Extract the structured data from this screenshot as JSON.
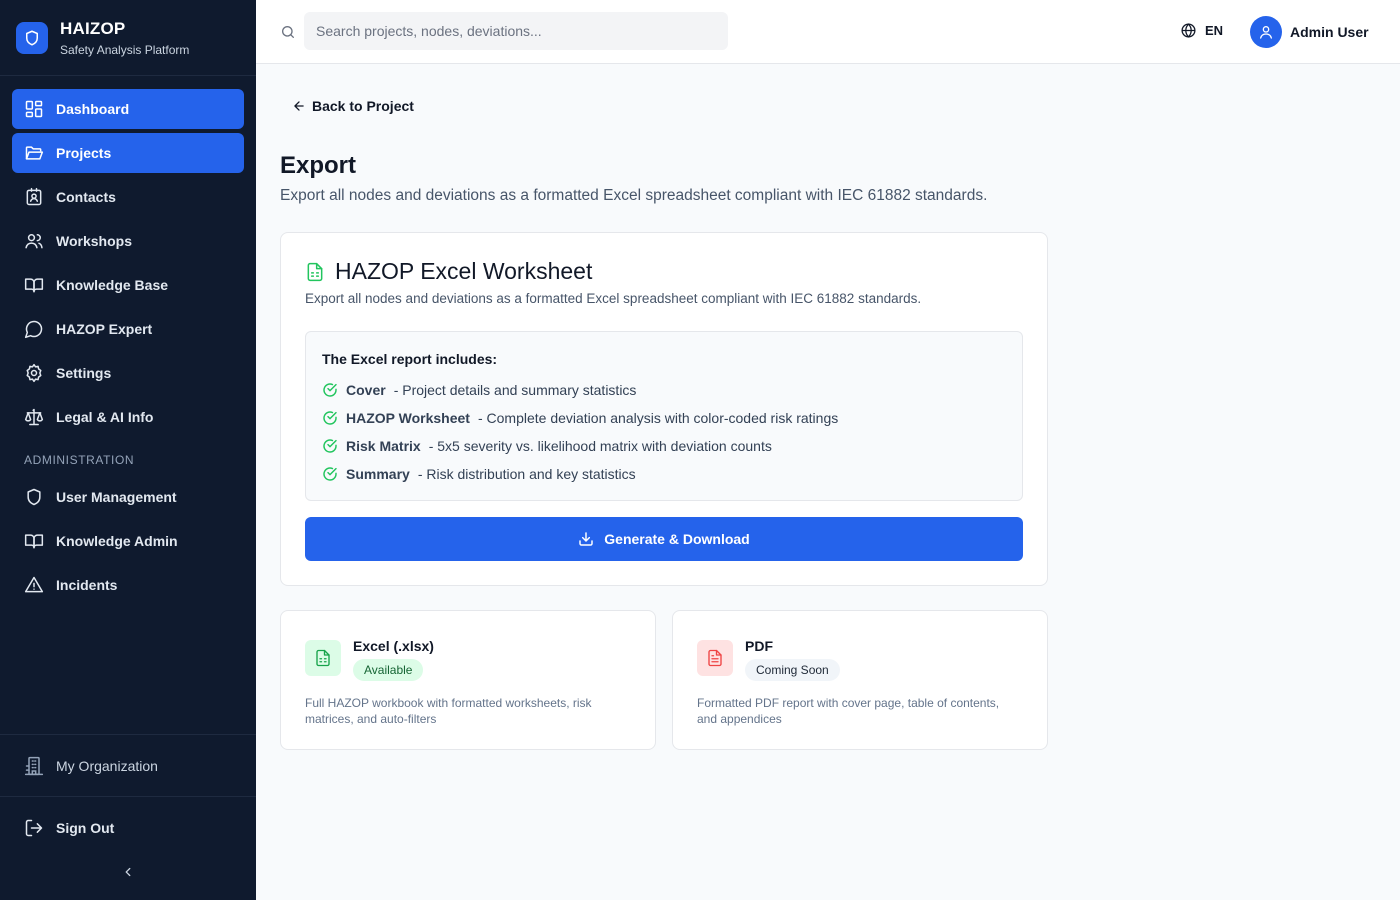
{
  "brand": {
    "title": "HAIZOP",
    "subtitle": "Safety Analysis Platform"
  },
  "sidebar": {
    "items": [
      {
        "label": "Dashboard",
        "icon": "dashboard-grid-icon",
        "active": true
      },
      {
        "label": "Projects",
        "icon": "folder-open-icon",
        "active": true
      },
      {
        "label": "Contacts",
        "icon": "contact-badge-icon"
      },
      {
        "label": "Workshops",
        "icon": "users-icon"
      },
      {
        "label": "Knowledge Base",
        "icon": "book-open-icon"
      },
      {
        "label": "HAZOP Expert",
        "icon": "chat-bubble-icon"
      },
      {
        "label": "Settings",
        "icon": "gear-icon"
      },
      {
        "label": "Legal & AI Info",
        "icon": "scale-icon"
      }
    ],
    "section_label": "ADMINISTRATION",
    "admin_items": [
      {
        "label": "User Management",
        "icon": "shield-icon"
      },
      {
        "label": "Knowledge Admin",
        "icon": "book-open-icon"
      },
      {
        "label": "Incidents",
        "icon": "warning-triangle-icon"
      }
    ],
    "org_label": "My Organization",
    "signout_label": "Sign Out"
  },
  "topbar": {
    "search_placeholder": "Search projects, nodes, deviations...",
    "language": "EN",
    "user_name": "Admin User"
  },
  "page": {
    "back_label": "Back to Project",
    "title": "Export",
    "description": "Export all nodes and deviations as a formatted Excel spreadsheet compliant with IEC 61882 standards."
  },
  "worksheet_card": {
    "title": "HAZOP Excel Worksheet",
    "description": "Export all nodes and deviations as a formatted Excel spreadsheet compliant with IEC 61882 standards.",
    "includes_title": "The Excel report includes:",
    "includes": [
      {
        "name": "Cover",
        "desc": "- Project details and summary statistics"
      },
      {
        "name": "HAZOP Worksheet",
        "desc": "- Complete deviation analysis with color-coded risk ratings"
      },
      {
        "name": "Risk Matrix",
        "desc": "- 5x5 severity vs. likelihood matrix with deviation counts"
      },
      {
        "name": "Summary",
        "desc": "- Risk distribution and key statistics"
      }
    ],
    "button_label": "Generate & Download"
  },
  "formats": [
    {
      "name": "Excel (.xlsx)",
      "status": "Available",
      "description": "Full HAZOP workbook with formatted worksheets, risk matrices, and auto-filters"
    },
    {
      "name": "PDF",
      "status": "Coming Soon",
      "description": "Formatted PDF report with cover page, table of contents, and appendices"
    }
  ],
  "colors": {
    "sidebar_bg": "#0f1a2e",
    "accent": "#2563eb",
    "success": "#22c55e",
    "pdf": "#ef4444"
  }
}
